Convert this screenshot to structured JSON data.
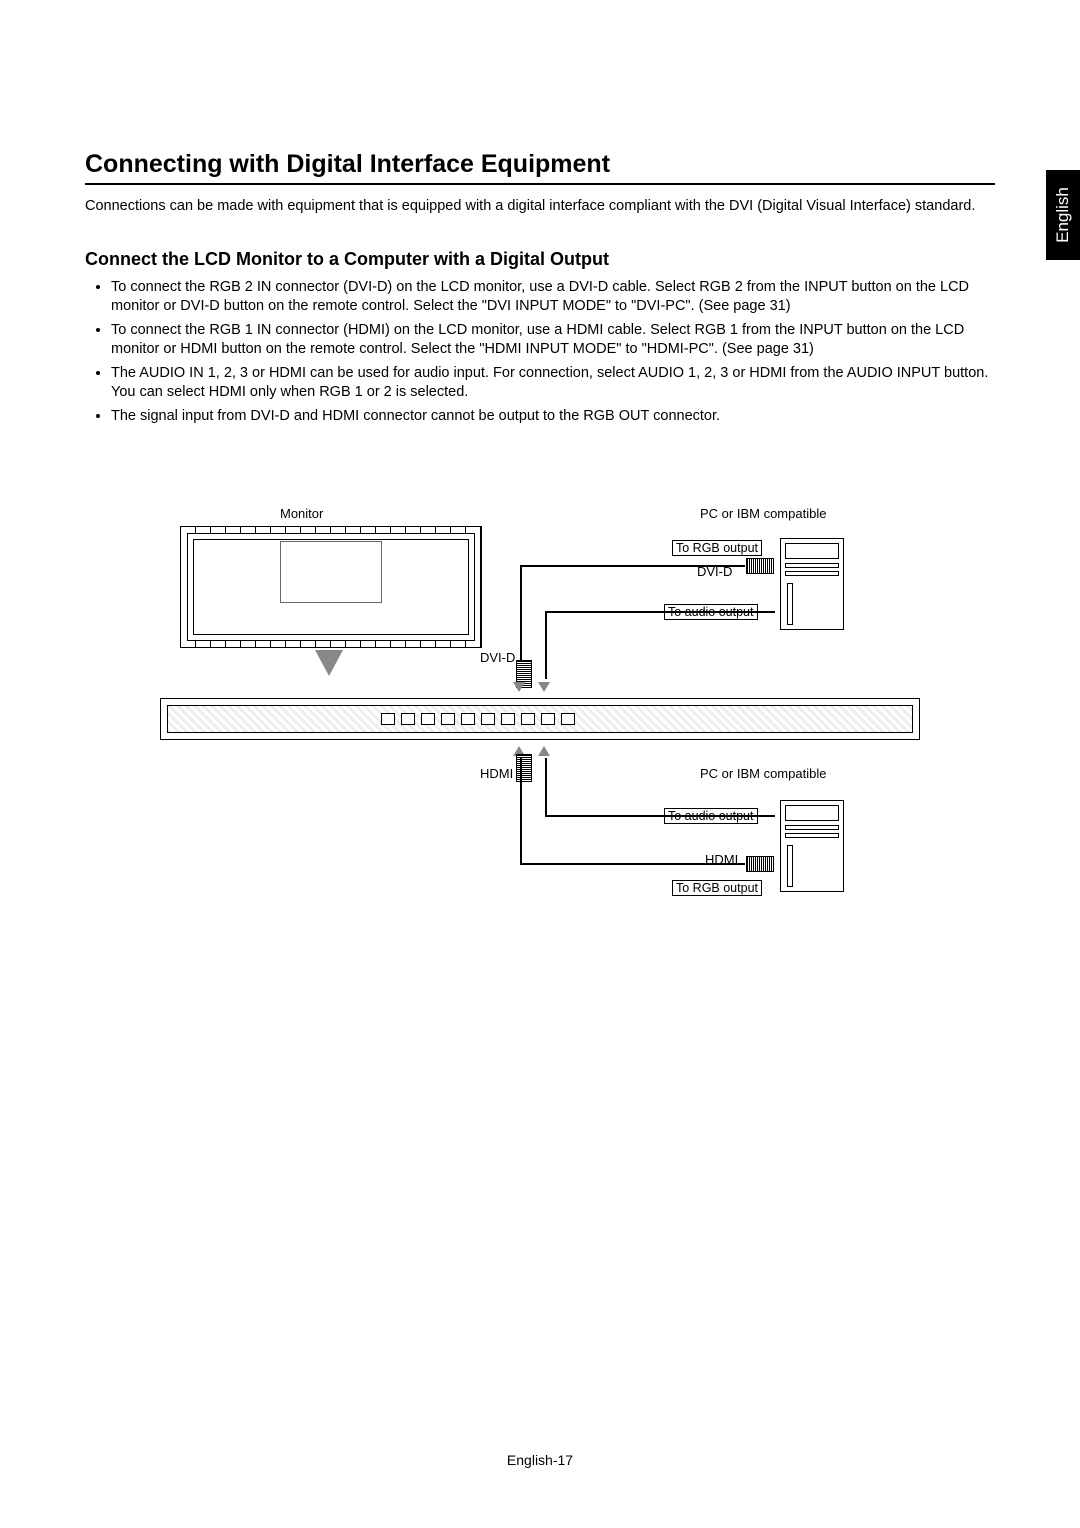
{
  "language_tab": "English",
  "title": "Connecting with Digital Interface Equipment",
  "intro": "Connections can be made with equipment that is equipped with a digital interface compliant with the DVI (Digital Visual Interface) standard.",
  "subtitle": "Connect the LCD Monitor to a Computer with a Digital Output",
  "bullets": [
    "To connect the RGB 2 IN connector (DVI-D) on the LCD monitor, use a DVI-D cable. Select RGB 2 from the INPUT button on the LCD monitor or DVI-D button on the remote control. Select the \"DVI INPUT MODE\" to \"DVI-PC\".  (See page 31)",
    "To connect the RGB 1 IN connector (HDMI) on the LCD monitor, use a HDMI cable. Select RGB 1 from the INPUT button on the LCD monitor or HDMI button on the remote control. Select the \"HDMI INPUT MODE\" to \"HDMI-PC\".  (See page 31)",
    "The AUDIO IN 1, 2, 3 or HDMI can be used for audio input. For connection, select AUDIO 1, 2, 3 or HDMI from the AUDIO INPUT button.  You can select HDMI only when RGB 1 or 2 is selected.",
    "The signal input from DVI-D and HDMI connector cannot be output to the RGB OUT connector."
  ],
  "diagram": {
    "monitor_label": "Monitor",
    "pc_label": "PC or IBM compatible",
    "to_rgb_output": "To RGB output",
    "to_audio_output": "To audio output",
    "dvi_d": "DVI-D",
    "hdmi": "HDMI"
  },
  "footer": "English-17"
}
